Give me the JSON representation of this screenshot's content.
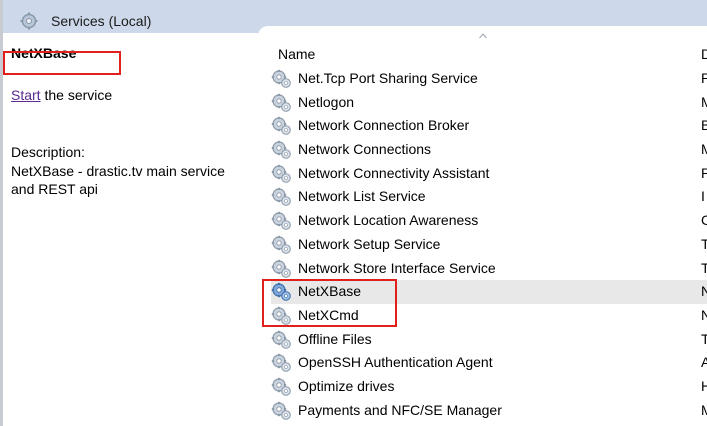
{
  "header": {
    "title": "Services (Local)",
    "icon": "gear-icon"
  },
  "left_pane": {
    "service_name": "NetXBase",
    "start_link": "Start",
    "start_suffix": " the service",
    "description_label": "Description:",
    "description_text": "NetXBase - drastic.tv main service and REST api"
  },
  "columns": {
    "name": "Name",
    "description": "D"
  },
  "services": [
    {
      "name": "Net.Tcp Port Sharing Service",
      "col2": "P",
      "selected": false
    },
    {
      "name": "Netlogon",
      "col2": "M",
      "selected": false
    },
    {
      "name": "Network Connection Broker",
      "col2": "B",
      "selected": false
    },
    {
      "name": "Network Connections",
      "col2": "M",
      "selected": false
    },
    {
      "name": "Network Connectivity Assistant",
      "col2": "P",
      "selected": false
    },
    {
      "name": "Network List Service",
      "col2": "I",
      "selected": false
    },
    {
      "name": "Network Location Awareness",
      "col2": "C",
      "selected": false
    },
    {
      "name": "Network Setup Service",
      "col2": "T",
      "selected": false
    },
    {
      "name": "Network Store Interface Service",
      "col2": "T",
      "selected": false
    },
    {
      "name": "NetXBase",
      "col2": "N",
      "selected": true
    },
    {
      "name": "NetXCmd",
      "col2": "N",
      "selected": false
    },
    {
      "name": "Offline Files",
      "col2": "T",
      "selected": false
    },
    {
      "name": "OpenSSH Authentication Agent",
      "col2": "A",
      "selected": false
    },
    {
      "name": "Optimize drives",
      "col2": "H",
      "selected": false
    },
    {
      "name": "Payments and NFC/SE Manager",
      "col2": "M",
      "selected": false
    }
  ],
  "colors": {
    "highlight": "#e0211b",
    "link": "#5a2a8c",
    "header_band": "#cdd9ea"
  }
}
